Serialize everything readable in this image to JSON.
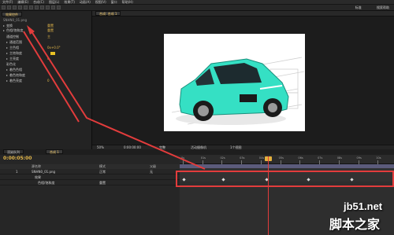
{
  "menubar": {
    "items": [
      "文件(F)",
      "编辑(E)",
      "合成(C)",
      "图层(L)",
      "效果(T)",
      "动画(A)",
      "视图(V)",
      "窗口",
      "帮助(H)"
    ]
  },
  "toolbar": {
    "right_label": "标准",
    "search_placeholder": "搜索帮助"
  },
  "left_panel": {
    "tab": "效果控件",
    "title": "SNHN0_01.png",
    "rows": [
      {
        "label": "变换",
        "value": "重置"
      },
      {
        "label": "色相/饱和度",
        "value": "重置"
      },
      {
        "label": "通道控制",
        "value": "主"
      },
      {
        "label": "通道范围",
        "value": ""
      },
      {
        "label": "主色相",
        "value": "0x+0.0°"
      },
      {
        "label": "主饱和度",
        "value": "0"
      },
      {
        "label": "主亮度",
        "value": "0"
      },
      {
        "label": "彩色化",
        "value": ""
      },
      {
        "label": "着色色相",
        "value": ""
      },
      {
        "label": "着色饱和度",
        "value": ""
      },
      {
        "label": "着色亮度",
        "value": "0"
      }
    ]
  },
  "comp_panel": {
    "tab": "合成: 合成 1",
    "footer": {
      "zoom": "50%",
      "time": "0:00:00:00",
      "quality": "完整",
      "camera": "活动摄像机",
      "view": "1个视图"
    }
  },
  "timeline": {
    "tabs": [
      "渲染队列",
      "合成 1"
    ],
    "timecode": "0:00:05:00",
    "header": {
      "source": "源名称",
      "mode": "模式",
      "parent": "父级"
    },
    "layers": [
      {
        "num": "1",
        "name": "SNHN0_01.png",
        "mode": "正常",
        "parent": "无"
      },
      {
        "num": "",
        "name": "效果",
        "mode": "",
        "parent": ""
      },
      {
        "num": "",
        "name": "色相/饱和度",
        "mode": "重置",
        "parent": ""
      }
    ],
    "ruler_labels": [
      "0s",
      "01s",
      "02s",
      "03s",
      "04s",
      "05s",
      "06s",
      "07s",
      "08s",
      "09s",
      "10s"
    ]
  },
  "watermark": {
    "site": "jb51.net",
    "name": "脚本之家"
  },
  "colors": {
    "accent": "#e4b84a",
    "highlight": "#e23c3c",
    "car": "#35e0c4"
  }
}
